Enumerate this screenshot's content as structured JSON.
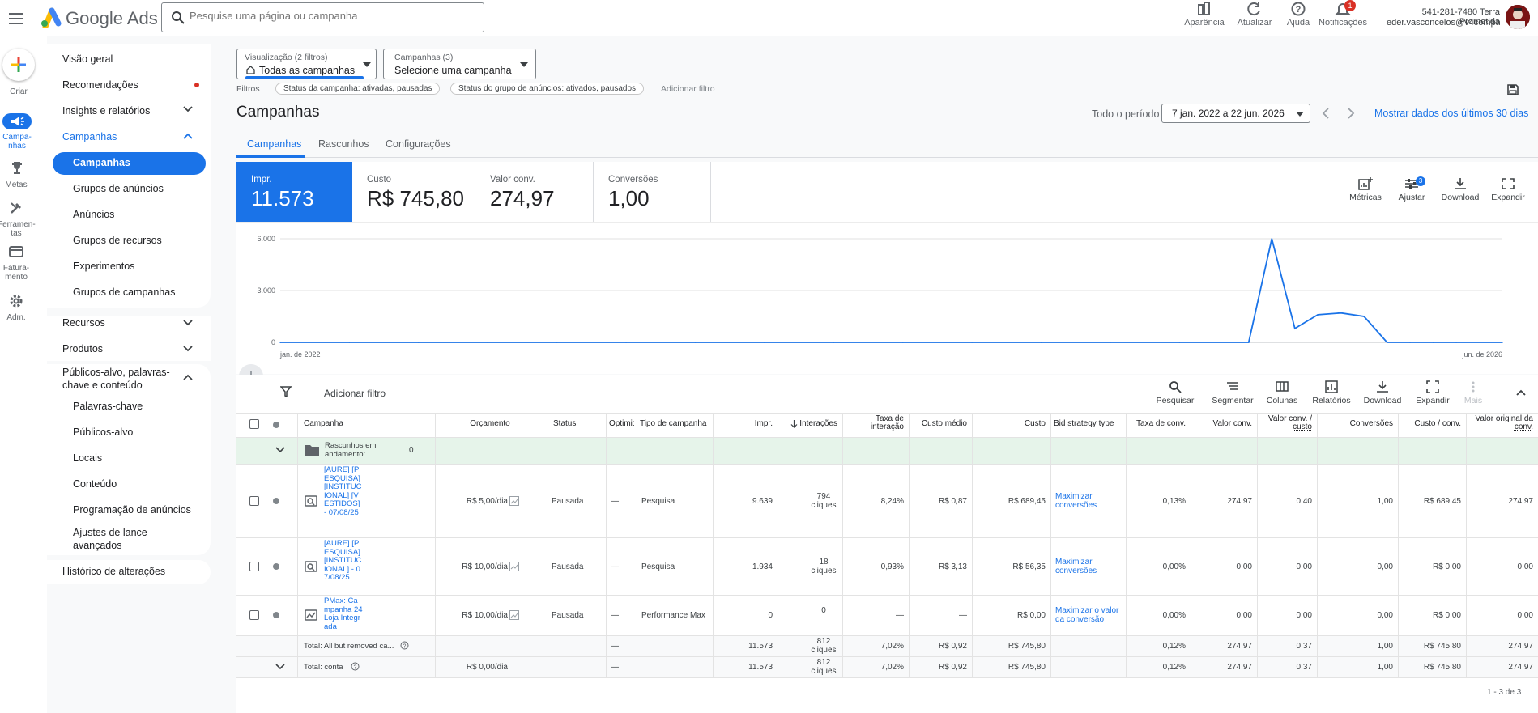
{
  "app": {
    "brand": "Google Ads"
  },
  "search": {
    "placeholder": "Pesquise uma página ou campanha"
  },
  "topbar": {
    "appearance": "Aparência",
    "refresh": "Atualizar",
    "help": "Ajuda",
    "notifications": "Notificações",
    "notification_count": "1",
    "account_line1": "541-281-7480 Terra Prometida",
    "account_line2": "eder.vasconcelos@v4compan..."
  },
  "rail": {
    "create": "Criar",
    "campaigns": "Campa-nhas",
    "goals": "Metas",
    "tools": "Ferramen-tas",
    "billing": "Fatura-mento",
    "admin": "Adm."
  },
  "nav": {
    "overview": "Visão geral",
    "recommendations": "Recomendações",
    "insights": "Insights e relatórios",
    "campaigns_group": "Campanhas",
    "campaigns_sub": [
      "Campanhas",
      "Grupos de anúncios",
      "Anúncios",
      "Grupos de recursos",
      "Experimentos",
      "Grupos de campanhas"
    ],
    "resources": "Recursos",
    "products": "Produtos",
    "audiences_group": "Públicos-alvo, palavras-chave e conteúdo",
    "audiences_sub": [
      "Palavras-chave",
      "Públicos-alvo",
      "Locais",
      "Conteúdo",
      "Programação de anúncios",
      "Ajustes de lance avançados"
    ],
    "history": "Histórico de alterações"
  },
  "filters": {
    "view_label": "Visualização (2 filtros)",
    "view_value": "Todas as campanhas",
    "campaign_label": "Campanhas (3)",
    "campaign_value": "Selecione uma campanha",
    "filters_label": "Filtros",
    "chip1": "Status da campanha: ativadas, pausadas",
    "chip2": "Status do grupo de anúncios: ativados, pausados",
    "add_filter": "Adicionar filtro"
  },
  "page": {
    "title": "Campanhas",
    "period_label": "Todo o período",
    "period_value": "7 jan. 2022 a 22 jun. 2026",
    "last30": "Mostrar dados dos últimos 30 dias",
    "tabs": [
      "Campanhas",
      "Rascunhos",
      "Configurações"
    ]
  },
  "scorecards": [
    {
      "label": "Impr.",
      "value": "11.573"
    },
    {
      "label": "Custo",
      "value": "R$ 745,80"
    },
    {
      "label": "Valor conv.",
      "value": "274,97"
    },
    {
      "label": "Conversões",
      "value": "1,00"
    }
  ],
  "chart_actions": {
    "metrics": "Métricas",
    "adjust": "Ajustar",
    "adjust_badge": "3",
    "download": "Download",
    "expand": "Expandir"
  },
  "chart_data": {
    "type": "line",
    "x": [
      "2022-01",
      "2022-04",
      "2022-07",
      "2022-10",
      "2023-01",
      "2023-04",
      "2023-07",
      "2023-10",
      "2024-01",
      "2024-04",
      "2024-07",
      "2024-10",
      "2025-01",
      "2025-04",
      "2025-07",
      "2025-08",
      "2025-09",
      "2025-10",
      "2025-11",
      "2025-12",
      "2026-01",
      "2026-02",
      "2026-03",
      "2026-04",
      "2026-06"
    ],
    "series": [
      {
        "values": [
          0,
          0,
          0,
          0,
          0,
          0,
          0,
          0,
          0,
          0,
          0,
          0,
          0,
          0,
          0,
          6000,
          800,
          1600,
          1700,
          1500,
          0,
          0,
          0,
          0,
          0
        ]
      }
    ],
    "yticks": [
      "6.000",
      "3.000",
      "0"
    ],
    "ylim": [
      0,
      6000
    ],
    "xtick_start": "jan. de 2022",
    "xtick_end": "jun. de 2026",
    "color": "#1a73e8"
  },
  "toolbar": {
    "add_filter": "Adicionar filtro",
    "search": "Pesquisar",
    "segment": "Segmentar",
    "columns": "Colunas",
    "reports": "Relatórios",
    "download": "Download",
    "expand": "Expandir",
    "more": "Mais"
  },
  "table": {
    "headers": {
      "campaign": "Campanha",
      "budget": "Orçamento",
      "status": "Status",
      "optim": "Optimi:",
      "type": "Tipo de campanha",
      "impr": "Impr.",
      "interactions": "Interações",
      "int_rate": "Taxa de interação",
      "avg_cost": "Custo médio",
      "cost": "Custo",
      "bid": "Bid strategy type",
      "conv_rate": "Taxa de conv.",
      "conv_value": "Valor conv.",
      "value_cost": "Valor conv. / custo",
      "conversions": "Conversões",
      "cost_conv": "Custo / conv.",
      "orig_value": "Valor original da conv."
    },
    "drafts_label": "Rascunhos em andamento:",
    "drafts_count": "0",
    "rows": [
      {
        "campaign": "[AURE] [PESQUISA] [INSTITUCIONAL] [VESTIDOS] - 07/08/25",
        "budget": "R$ 5,00/dia",
        "status": "Pausada",
        "optim": "—",
        "type": "Pesquisa",
        "impr": "9.639",
        "interactions": "794 cliques",
        "int_rate": "8,24%",
        "avg_cost": "R$ 0,87",
        "cost": "R$ 689,45",
        "bid": "Maximizar conversões",
        "conv_rate": "0,13%",
        "conv_value": "274,97",
        "value_cost": "0,40",
        "conversions": "1,00",
        "cost_conv": "R$ 689,45",
        "orig_value": "274,97"
      },
      {
        "campaign": "[AURE] [PESQUISA] [INSTITUCIONAL] - 07/08/25",
        "budget": "R$ 10,00/dia",
        "status": "Pausada",
        "optim": "—",
        "type": "Pesquisa",
        "impr": "1.934",
        "interactions": "18 cliques",
        "int_rate": "0,93%",
        "avg_cost": "R$ 3,13",
        "cost": "R$ 56,35",
        "bid": "Maximizar conversões",
        "conv_rate": "0,00%",
        "conv_value": "0,00",
        "value_cost": "0,00",
        "conversions": "0,00",
        "cost_conv": "R$ 0,00",
        "orig_value": "0,00"
      },
      {
        "campaign": "PMax: Campanha 24 Loja Integrada",
        "budget": "R$ 10,00/dia",
        "status": "Pausada",
        "optim": "—",
        "type": "Performance Max",
        "impr": "0",
        "interactions": "0",
        "int_rate": "—",
        "avg_cost": "—",
        "cost": "R$ 0,00",
        "bid": "Maximizar o valor da conversão",
        "conv_rate": "0,00%",
        "conv_value": "0,00",
        "value_cost": "0,00",
        "conversions": "0,00",
        "cost_conv": "R$ 0,00",
        "orig_value": "0,00"
      }
    ],
    "totals": [
      {
        "campaign": "Total: All but removed ca...",
        "budget": "",
        "status": "",
        "optim": "—",
        "type": "",
        "impr": "11.573",
        "interactions": "812 cliques",
        "int_rate": "7,02%",
        "avg_cost": "R$ 0,92",
        "cost": "R$ 745,80",
        "bid": "",
        "conv_rate": "0,12%",
        "conv_value": "274,97",
        "value_cost": "0,37",
        "conversions": "1,00",
        "cost_conv": "R$ 745,80",
        "orig_value": "274,97"
      },
      {
        "campaign": "Total: conta",
        "budget": "R$ 0,00/dia",
        "status": "",
        "optim": "—",
        "type": "",
        "impr": "11.573",
        "interactions": "812 cliques",
        "int_rate": "7,02%",
        "avg_cost": "R$ 0,92",
        "cost": "R$ 745,80",
        "bid": "",
        "conv_rate": "0,12%",
        "conv_value": "274,97",
        "value_cost": "0,37",
        "conversions": "1,00",
        "cost_conv": "R$ 745,80",
        "orig_value": "274,97"
      }
    ],
    "pagination": "1 - 3 de 3"
  }
}
